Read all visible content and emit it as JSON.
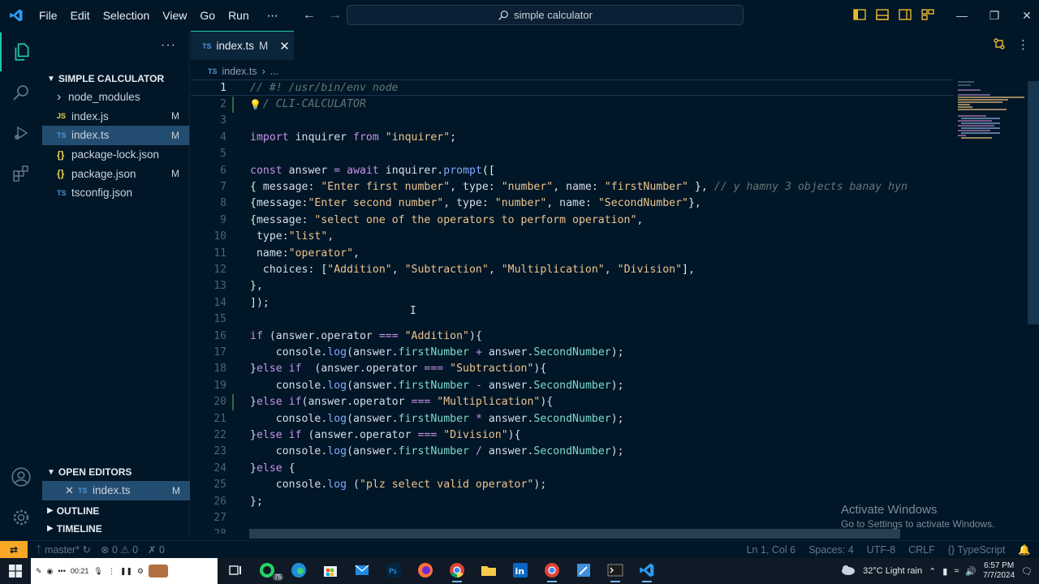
{
  "titlebar": {
    "menu": [
      "File",
      "Edit",
      "Selection",
      "View",
      "Go",
      "Run"
    ],
    "more": "⋯",
    "search": "simple calculator",
    "controls": {
      "minimize": "—",
      "restore": "❐",
      "close": "✕"
    }
  },
  "explorer": {
    "more": "···",
    "project_title": "SIMPLE CALCULATOR",
    "files": [
      {
        "name": "node_modules",
        "kind": "folder",
        "badge": ""
      },
      {
        "name": "index.js",
        "kind": "js",
        "badge": "M"
      },
      {
        "name": "index.ts",
        "kind": "ts",
        "badge": "M"
      },
      {
        "name": "package-lock.json",
        "kind": "json",
        "badge": ""
      },
      {
        "name": "package.json",
        "kind": "json",
        "badge": "M"
      },
      {
        "name": "tsconfig.json",
        "kind": "ts",
        "badge": ""
      }
    ],
    "open_editors_title": "OPEN EDITORS",
    "open_editor": {
      "name": "index.ts",
      "badge": "M"
    },
    "outline_title": "OUTLINE",
    "timeline_title": "TIMELINE"
  },
  "tab": {
    "icon": "TS",
    "name": "index.ts",
    "modified": "M",
    "close": "✕"
  },
  "breadcrumb": {
    "icon": "TS",
    "file": "index.ts",
    "rest": "..."
  },
  "code_lines": [
    [
      [
        "c",
        "// #! /usr/bin/env node"
      ]
    ],
    [
      [
        "c",
        "  / CLI-CALCULATOR"
      ]
    ],
    [],
    [
      [
        "k",
        "import"
      ],
      [
        "v",
        " inquirer "
      ],
      [
        "k",
        "from"
      ],
      [
        "v",
        " "
      ],
      [
        "s",
        "\"inquirer\""
      ],
      [
        "v",
        ";"
      ]
    ],
    [],
    [
      [
        "k",
        "const"
      ],
      [
        "v",
        " answer "
      ],
      [
        "o",
        "="
      ],
      [
        "v",
        " "
      ],
      [
        "k",
        "await"
      ],
      [
        "v",
        " inquirer."
      ],
      [
        "f",
        "prompt"
      ],
      [
        "b",
        "(["
      ]
    ],
    [
      [
        "b",
        "{"
      ],
      [
        "v",
        " message: "
      ],
      [
        "s",
        "\"Enter first number\""
      ],
      [
        "v",
        ", type: "
      ],
      [
        "s",
        "\"number\""
      ],
      [
        "v",
        ", name: "
      ],
      [
        "s",
        "\"firstNumber\""
      ],
      [
        "v",
        " "
      ],
      [
        "b",
        "}"
      ],
      [
        "v",
        ", "
      ],
      [
        "c",
        "// y hamny 3 objects banay hyn"
      ]
    ],
    [
      [
        "b",
        "{"
      ],
      [
        "v",
        "message:"
      ],
      [
        "s",
        "\"Enter second number\""
      ],
      [
        "v",
        ", type: "
      ],
      [
        "s",
        "\"number\""
      ],
      [
        "v",
        ", name: "
      ],
      [
        "s",
        "\"SecondNumber\""
      ],
      [
        "b",
        "}"
      ],
      [
        "v",
        ","
      ]
    ],
    [
      [
        "b",
        "{"
      ],
      [
        "v",
        "message: "
      ],
      [
        "s",
        "\"select one of the operators to perform operation\""
      ],
      [
        "v",
        ","
      ]
    ],
    [
      [
        "v",
        " type:"
      ],
      [
        "s",
        "\"list\""
      ],
      [
        "v",
        ","
      ]
    ],
    [
      [
        "v",
        " name:"
      ],
      [
        "s",
        "\"operator\""
      ],
      [
        "v",
        ","
      ]
    ],
    [
      [
        "v",
        "  choices: "
      ],
      [
        "b",
        "["
      ],
      [
        "s",
        "\"Addition\""
      ],
      [
        "v",
        ", "
      ],
      [
        "s",
        "\"Subtraction\""
      ],
      [
        "v",
        ", "
      ],
      [
        "s",
        "\"Multiplication\""
      ],
      [
        "v",
        ", "
      ],
      [
        "s",
        "\"Division\""
      ],
      [
        "b",
        "]"
      ],
      [
        "v",
        ","
      ]
    ],
    [
      [
        "b",
        "}"
      ],
      [
        "v",
        ","
      ]
    ],
    [
      [
        "b",
        "]"
      ],
      [
        "v",
        ");"
      ]
    ],
    [],
    [
      [
        "k",
        "if"
      ],
      [
        "v",
        " (answer.operator "
      ],
      [
        "o",
        "==="
      ],
      [
        "v",
        " "
      ],
      [
        "s",
        "\"Addition\""
      ],
      [
        "v",
        "){"
      ]
    ],
    [
      [
        "v",
        "    console."
      ],
      [
        "f",
        "log"
      ],
      [
        "v",
        "(answer."
      ],
      [
        "p",
        "firstNumber"
      ],
      [
        "v",
        " "
      ],
      [
        "o",
        "+"
      ],
      [
        "v",
        " answer."
      ],
      [
        "p",
        "SecondNumber"
      ],
      [
        "v",
        ");"
      ]
    ],
    [
      [
        "v",
        "}"
      ],
      [
        "k",
        "else if"
      ],
      [
        "v",
        "  (answer.operator "
      ],
      [
        "o",
        "==="
      ],
      [
        "v",
        " "
      ],
      [
        "s",
        "\"Subtraction\""
      ],
      [
        "v",
        "){"
      ]
    ],
    [
      [
        "v",
        "    console."
      ],
      [
        "f",
        "log"
      ],
      [
        "v",
        "(answer."
      ],
      [
        "p",
        "firstNumber"
      ],
      [
        "v",
        " "
      ],
      [
        "o",
        "-"
      ],
      [
        "v",
        " answer."
      ],
      [
        "p",
        "SecondNumber"
      ],
      [
        "v",
        ");"
      ]
    ],
    [
      [
        "v",
        "}"
      ],
      [
        "k",
        "else if"
      ],
      [
        "v",
        "(answer.operator "
      ],
      [
        "o",
        "==="
      ],
      [
        "v",
        " "
      ],
      [
        "s",
        "\"Multiplication\""
      ],
      [
        "v",
        "){"
      ]
    ],
    [
      [
        "v",
        "    console."
      ],
      [
        "f",
        "log"
      ],
      [
        "v",
        "(answer."
      ],
      [
        "p",
        "firstNumber"
      ],
      [
        "v",
        " "
      ],
      [
        "o",
        "*"
      ],
      [
        "v",
        " answer."
      ],
      [
        "p",
        "SecondNumber"
      ],
      [
        "v",
        ");"
      ]
    ],
    [
      [
        "v",
        "}"
      ],
      [
        "k",
        "else if"
      ],
      [
        "v",
        " (answer.operator "
      ],
      [
        "o",
        "==="
      ],
      [
        "v",
        " "
      ],
      [
        "s",
        "\"Division\""
      ],
      [
        "v",
        "){"
      ]
    ],
    [
      [
        "v",
        "    console."
      ],
      [
        "f",
        "log"
      ],
      [
        "v",
        "(answer."
      ],
      [
        "p",
        "firstNumber"
      ],
      [
        "v",
        " "
      ],
      [
        "o",
        "/"
      ],
      [
        "v",
        " answer."
      ],
      [
        "p",
        "SecondNumber"
      ],
      [
        "v",
        ");"
      ]
    ],
    [
      [
        "v",
        "}"
      ],
      [
        "k",
        "else"
      ],
      [
        "v",
        " {"
      ]
    ],
    [
      [
        "v",
        "    console."
      ],
      [
        "f",
        "log"
      ],
      [
        "v",
        " ("
      ],
      [
        "s",
        "\"plz select valid operator\""
      ],
      [
        "v",
        ");"
      ]
    ],
    [
      [
        "v",
        "};"
      ]
    ],
    [],
    []
  ],
  "activate": {
    "line1": "Activate Windows",
    "line2": "Go to Settings to activate Windows."
  },
  "statusbar": {
    "branch": "master*",
    "errors": "0",
    "warnings": "0",
    "ports": "0",
    "position": "Ln 1, Col 6",
    "spaces": "Spaces: 4",
    "encoding": "UTF-8",
    "eol": "CRLF",
    "language": "TypeScript"
  },
  "taskbar": {
    "recorder_time": "00:21",
    "whatsapp_count": "75",
    "weather": "32°C  Light rain",
    "time": "6:57 PM",
    "date": "7/7/2024"
  },
  "colors": {
    "accent": "#21c7a8",
    "background": "#011627",
    "status_remote": "#f9a825"
  }
}
